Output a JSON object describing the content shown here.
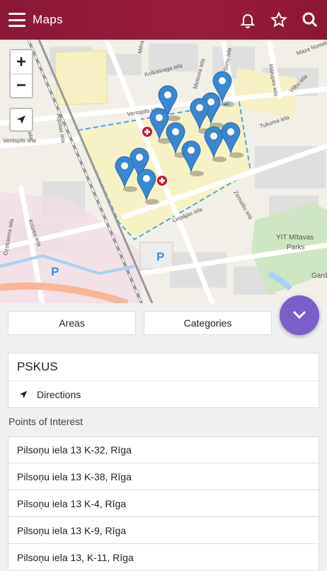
{
  "appbar": {
    "title": "Maps",
    "icons": [
      "menu-icon",
      "bell-icon",
      "star-icon",
      "search-icon"
    ]
  },
  "map": {
    "zoom_in_label": "+",
    "zoom_out_label": "−",
    "street_labels": [
      "Ventspils iela",
      "Ventspils iela",
      "Atpūtas iela",
      "Kolkasraga iela",
      "Meteora iela",
      "Tukuma iela",
      "Zemaišu iela",
      "Liepājas iela",
      "Krūzes iela",
      "Ozolciema iela",
      "Mārupes iela",
      "Viļķu iela",
      "Maza Nometņu",
      "Dikļu iela",
      "Sonu iela",
      "Mēra iela"
    ],
    "park_label_line1": "YIT Mītavas",
    "park_label_line2": "Parks",
    "garden_label": "Garde",
    "parking_label": "P",
    "colors": {
      "pin": "#3a86d0",
      "area_border": "#4fa9d9",
      "hospital": "#c8102e"
    }
  },
  "filters": {
    "areas_label": "Areas",
    "categories_label": "Categories"
  },
  "selected": {
    "name": "PSKUS",
    "directions_label": "Directions"
  },
  "poi": {
    "title": "Points of Interest",
    "items": [
      "Pilsoņu iela 13 K-32, Rīga",
      "Pilsoņu iela 13 K-38, Rīga",
      "Pilsoņu iela 13 K-4, Rīga",
      "Pilsoņu iela 13 K-9, Rīga",
      "Pilsoņu iela 13, K-11, Rīga"
    ]
  },
  "theme": {
    "appbar": "#8b1737",
    "fab": "#7b5fc9"
  }
}
